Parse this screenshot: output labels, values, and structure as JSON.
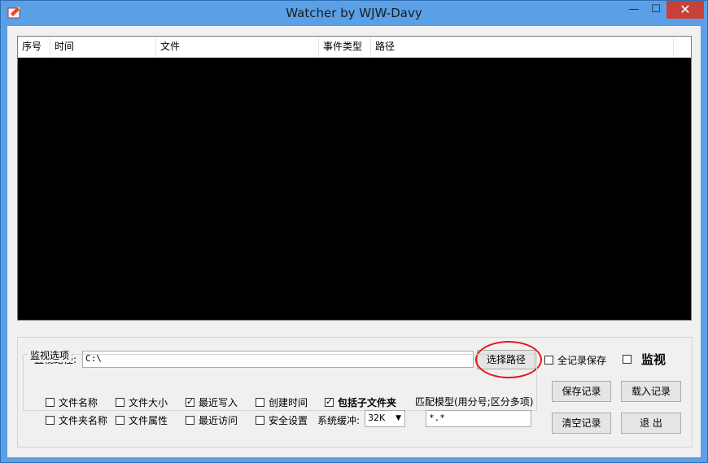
{
  "window": {
    "title": "Watcher by WJW-Davy",
    "minimize": "—",
    "maximize": "☐",
    "close": "✕"
  },
  "list": {
    "columns": [
      "序号",
      "时间",
      "文件",
      "事件类型",
      "路径"
    ]
  },
  "path": {
    "label": "监视路径:",
    "value": "C:\\",
    "browse_button": "选择路径"
  },
  "options": {
    "save_all": {
      "label": "全记录保存",
      "checked": false
    },
    "monitor": {
      "label": "监视",
      "checked": false
    },
    "group_title": "监视选项",
    "file_name": {
      "label": "文件名称",
      "checked": false
    },
    "folder_name": {
      "label": "文件夹名称",
      "checked": false
    },
    "file_size": {
      "label": "文件大小",
      "checked": false
    },
    "file_attr": {
      "label": "文件属性",
      "checked": false
    },
    "last_write": {
      "label": "最近写入",
      "checked": true
    },
    "last_access": {
      "label": "最近访问",
      "checked": false
    },
    "creation_time": {
      "label": "创建时间",
      "checked": false
    },
    "security": {
      "label": "安全设置",
      "checked": false
    },
    "include_sub": {
      "label": "包括子文件夹",
      "checked": true
    },
    "buffer_label": "系统缓冲:",
    "buffer_value": "32K",
    "pattern_label": "匹配模型(用分号;区分多项)",
    "pattern_value": "*.*"
  },
  "buttons": {
    "save_log": "保存记录",
    "load_log": "载入记录",
    "clear_log": "清空记录",
    "exit": "退 出"
  },
  "colors": {
    "titlebar": "#5aa0e6",
    "close": "#c7413a",
    "annotation": "#e01a1a"
  }
}
